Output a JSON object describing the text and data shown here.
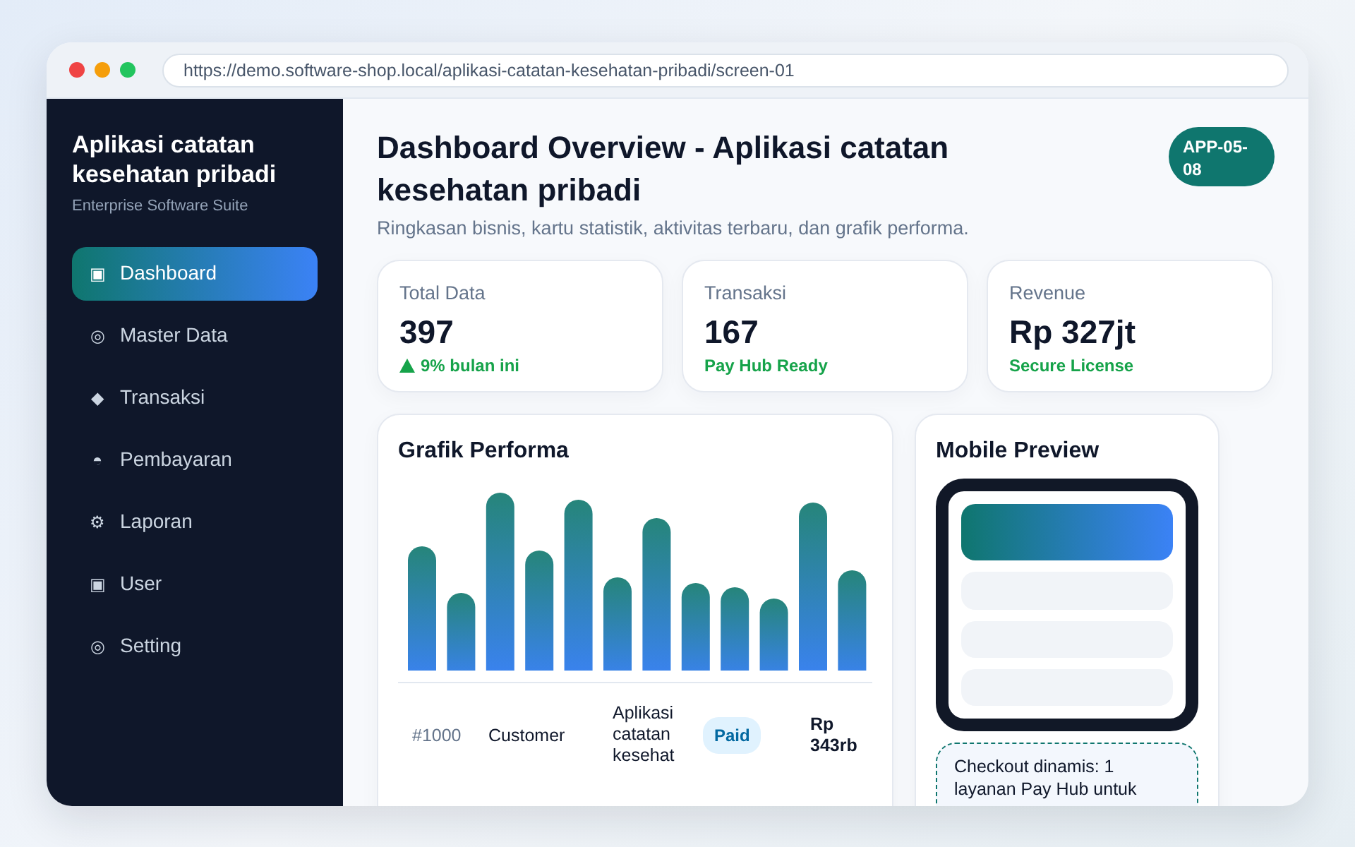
{
  "browser": {
    "url": "https://demo.software-shop.local/aplikasi-catatan-kesehatan-pribadi/screen-01"
  },
  "sidebar": {
    "title": "Aplikasi catatan kesehatan pribadi",
    "subtitle": "Enterprise Software Suite",
    "items": [
      {
        "icon": "▣",
        "label": "Dashboard",
        "selected": true
      },
      {
        "icon": "◎",
        "label": "Master Data",
        "selected": false
      },
      {
        "icon": "◆",
        "label": "Transaksi",
        "selected": false
      },
      {
        "icon": "◓",
        "label": "Pembayaran",
        "selected": false
      },
      {
        "icon": "⚙",
        "label": "Laporan",
        "selected": false
      },
      {
        "icon": "▣",
        "label": "User",
        "selected": false
      },
      {
        "icon": "◎",
        "label": "Setting",
        "selected": false
      }
    ]
  },
  "header": {
    "title": "Dashboard Overview - Aplikasi catatan kesehatan pribadi",
    "subtitle": "Ringkasan bisnis, kartu statistik, aktivitas terbaru, dan grafik performa.",
    "badge": "APP-05-08"
  },
  "stats": [
    {
      "label": "Total Data",
      "value": "397",
      "note": "9% bulan ini",
      "trend_up": true
    },
    {
      "label": "Transaksi",
      "value": "167",
      "note": "Pay Hub Ready",
      "trend_up": false
    },
    {
      "label": "Revenue",
      "value": "Rp 327jt",
      "note": "Secure License",
      "trend_up": false
    }
  ],
  "chart_card": {
    "title": "Grafik Performa",
    "table_row": {
      "id": "#1000",
      "customer": "Customer",
      "product": "Aplikasi catatan kesehat",
      "status": "Paid",
      "amount": "Rp 343rb"
    }
  },
  "mobile_preview": {
    "title": "Mobile Preview",
    "note": "Checkout dinamis: 1 layanan Pay Hub untuk"
  }
}
